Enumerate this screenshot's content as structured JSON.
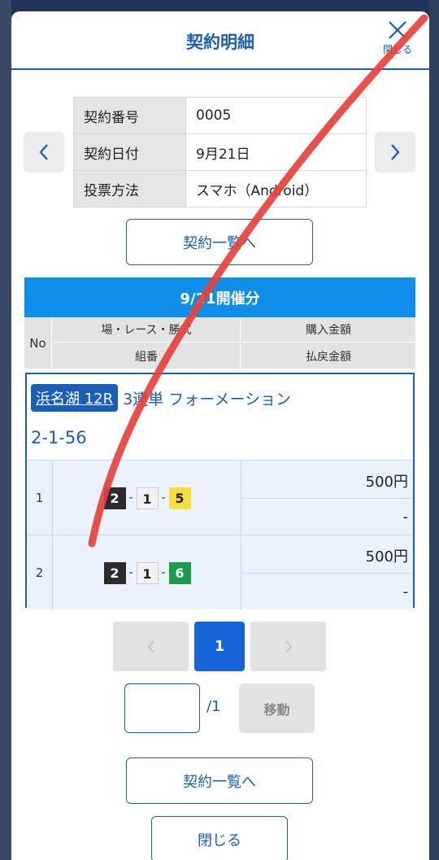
{
  "modal": {
    "title": "契約明細",
    "close_label": "閉じる"
  },
  "contract_info": [
    {
      "label": "契約番号",
      "value": "0005"
    },
    {
      "label": "契約日付",
      "value": "9月21日"
    },
    {
      "label": "投票方法",
      "value": "スマホ（Android）"
    }
  ],
  "list_button_label": "契約一覧へ",
  "day_header": "9/21開催分",
  "columns": {
    "no": "No",
    "race_type": "場・レース・勝式",
    "purchase_amount": "購入金額",
    "combination": "組番",
    "refund_amount": "払戻金額"
  },
  "bet": {
    "venue_race": "浜名湖 12R",
    "bet_type": "3連単 フォーメーション",
    "combo": "2-1-56",
    "rows": [
      {
        "no": "1",
        "nums": [
          "2",
          "1",
          "5"
        ],
        "purchase": "500円",
        "refund": "-"
      },
      {
        "no": "2",
        "nums": [
          "2",
          "1",
          "6"
        ],
        "purchase": "500円",
        "refund": "-"
      }
    ]
  },
  "pagination": {
    "current": "1",
    "total": "/1",
    "move_label": "移動"
  },
  "bottom_buttons": {
    "list_label": "契約一覧へ",
    "close_label": "閉じる"
  },
  "colors": {
    "accent": "#1b5eb8",
    "header_blue": "#0d8ee8",
    "annotation_red": "#e8413a"
  }
}
